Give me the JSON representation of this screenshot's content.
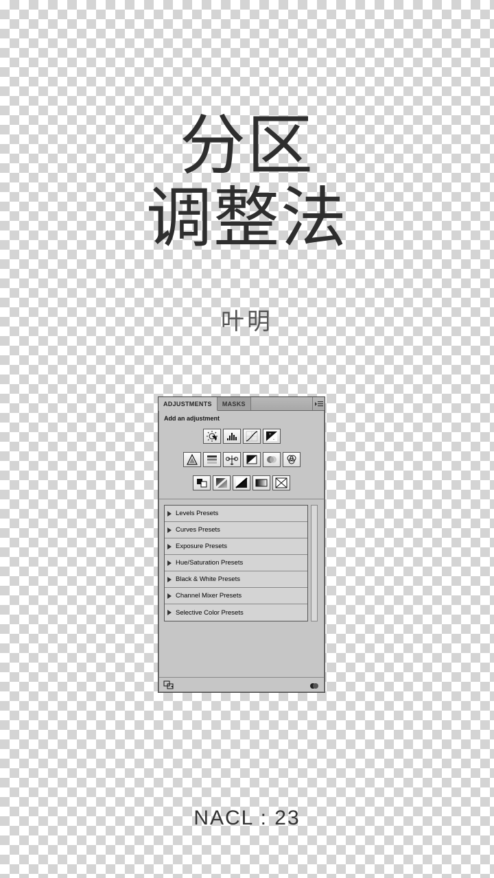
{
  "title": {
    "line1": "分区",
    "line2": "调整法"
  },
  "author": "叶明",
  "footnote": "NACL : 23",
  "panel": {
    "tabs": {
      "active": "ADJUSTMENTS",
      "inactive": "MASKS"
    },
    "subtitle": "Add an adjustment",
    "icons_row1": [
      "brightness-contrast",
      "levels",
      "curves",
      "exposure"
    ],
    "icons_row2": [
      "vibrance",
      "hue-saturation",
      "color-balance",
      "black-white",
      "photo-filter",
      "channel-mixer"
    ],
    "icons_row3": [
      "invert",
      "posterize",
      "threshold",
      "gradient-map",
      "selective-color"
    ],
    "presets": [
      "Levels Presets",
      "Curves Presets",
      "Exposure Presets",
      "Hue/Saturation Presets",
      "Black & White Presets",
      "Channel Mixer Presets",
      "Selective Color Presets"
    ]
  }
}
